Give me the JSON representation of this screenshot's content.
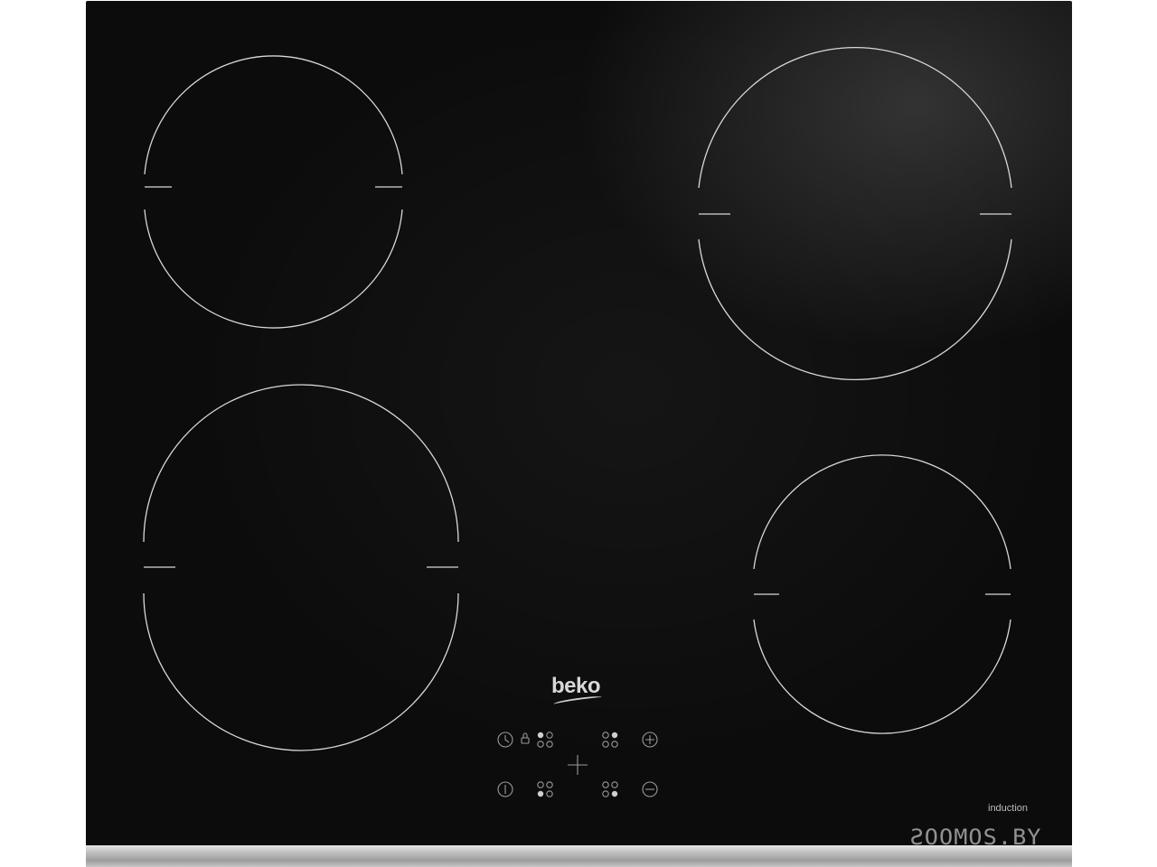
{
  "brand": {
    "logo_text": "beko"
  },
  "hob": {
    "type_label": "induction",
    "zones": [
      {
        "id": "rear-left",
        "size": "small"
      },
      {
        "id": "rear-right",
        "size": "large"
      },
      {
        "id": "front-left",
        "size": "large"
      },
      {
        "id": "front-right",
        "size": "small"
      }
    ]
  },
  "controls": {
    "row1": [
      "timer-icon",
      "lock-icon",
      "zone-selector-icon",
      "zone-selector-icon",
      "plus-icon"
    ],
    "row2": [
      "power-icon",
      "zone-selector-icon",
      "zone-selector-icon",
      "minus-icon"
    ],
    "center": "cross-icon"
  },
  "watermark": {
    "text": "ƧOOMOS.BY"
  },
  "colors": {
    "glass": "#0c0c0c",
    "markings": "#d8d8d8",
    "trim": "#bdbdbd"
  }
}
